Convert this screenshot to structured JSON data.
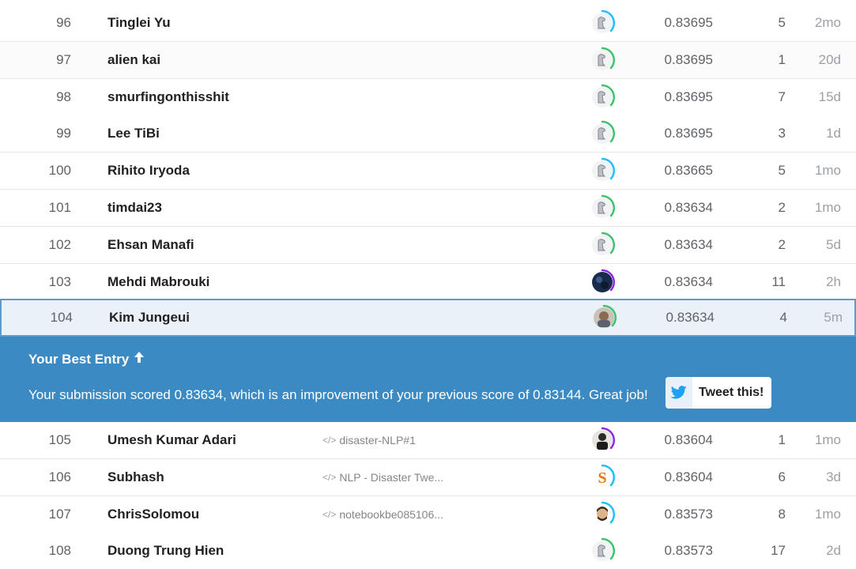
{
  "rows_top": [
    {
      "rank": "96",
      "name": "Tinglei Yu",
      "notebook": "",
      "score": "0.83695",
      "entries": "5",
      "last": "2mo",
      "avatar": "default",
      "ring": "blue"
    },
    {
      "rank": "97",
      "name": "alien kai",
      "notebook": "",
      "score": "0.83695",
      "entries": "1",
      "last": "20d",
      "avatar": "default",
      "ring": "green"
    },
    {
      "rank": "98",
      "name": "smurfingonthisshit",
      "notebook": "",
      "score": "0.83695",
      "entries": "7",
      "last": "15d",
      "avatar": "default",
      "ring": "green"
    },
    {
      "rank": "99",
      "name": "Lee TiBi",
      "notebook": "",
      "score": "0.83695",
      "entries": "3",
      "last": "1d",
      "avatar": "default",
      "ring": "green"
    },
    {
      "rank": "100",
      "name": "Rihito Iryoda",
      "notebook": "",
      "score": "0.83665",
      "entries": "5",
      "last": "1mo",
      "avatar": "default",
      "ring": "blue"
    },
    {
      "rank": "101",
      "name": "timdai23",
      "notebook": "",
      "score": "0.83634",
      "entries": "2",
      "last": "1mo",
      "avatar": "default",
      "ring": "green"
    },
    {
      "rank": "102",
      "name": "Ehsan Manafi",
      "notebook": "",
      "score": "0.83634",
      "entries": "2",
      "last": "5d",
      "avatar": "default",
      "ring": "green"
    },
    {
      "rank": "103",
      "name": "Mehdi Mabrouki",
      "notebook": "",
      "score": "0.83634",
      "entries": "11",
      "last": "2h",
      "avatar": "dark",
      "ring": "purple"
    }
  ],
  "highlight_row": {
    "rank": "104",
    "name": "Kim Jungeui",
    "notebook": "",
    "score": "0.83634",
    "entries": "4",
    "last": "5m",
    "avatar": "photo",
    "ring": "green"
  },
  "banner": {
    "title": "Your Best Entry",
    "arrow": "🡅",
    "message": "Your submission scored 0.83634, which is an improvement of your previous score of 0.83144. Great job!",
    "tweet_label": "Tweet this!"
  },
  "rows_bottom": [
    {
      "rank": "105",
      "name": "Umesh Kumar Adari",
      "notebook": "disaster-NLP#1",
      "score": "0.83604",
      "entries": "1",
      "last": "1mo",
      "avatar": "person",
      "ring": "purple"
    },
    {
      "rank": "106",
      "name": "Subhash",
      "notebook": "NLP - Disaster Twe...",
      "score": "0.83604",
      "entries": "6",
      "last": "3d",
      "avatar": "letter-s",
      "ring": "blue"
    },
    {
      "rank": "107",
      "name": "ChrisSolomou",
      "notebook": "notebookbe085106...",
      "score": "0.83573",
      "entries": "8",
      "last": "1mo",
      "avatar": "cartoon",
      "ring": "blue"
    },
    {
      "rank": "108",
      "name": "Duong Trung Hien",
      "notebook": "",
      "score": "0.83573",
      "entries": "17",
      "last": "2d",
      "avatar": "default",
      "ring": "green"
    }
  ],
  "colors": {
    "ring_blue": "#20beff",
    "ring_green": "#3dc26d",
    "ring_purple": "#8a2be2",
    "banner_bg": "#3c8ac3",
    "highlight_bg": "#ebf1f8",
    "twitter": "#1da1f2"
  },
  "icons": {
    "code": "code-icon",
    "tweet": "twitter-bird-icon",
    "up": "arrow-up-icon"
  }
}
